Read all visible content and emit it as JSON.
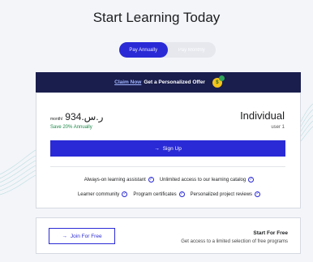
{
  "page": {
    "title": "Start Learning Today"
  },
  "billing_toggle": {
    "annual_label": "Pay Annually",
    "monthly_label": "Pay Monthly"
  },
  "offer": {
    "link_text": "Claim Now",
    "text": "Get a Personalized Offer",
    "coin_symbol": "$"
  },
  "plan": {
    "period": "month/",
    "amount": "ر.س.934",
    "save_text": "Save 20% Annually",
    "name": "Individual",
    "users": "user 1",
    "signup_icon": "→",
    "signup_label": "Sign Up",
    "features_row1": [
      "Always-on learning assistant",
      "Unlimited access to our learning catalog"
    ],
    "features_row2": [
      "Learner community",
      "Program certificates",
      "Personalized project reviews"
    ]
  },
  "free": {
    "button_icon": "→",
    "button_label": "Join For Free",
    "title": "Start For Free",
    "description": "Get access to a limited selection of free programs"
  },
  "colors": {
    "accent": "#2a2ad6",
    "offer_bg": "#1a1e4d",
    "save_green": "#1e8a4a"
  }
}
